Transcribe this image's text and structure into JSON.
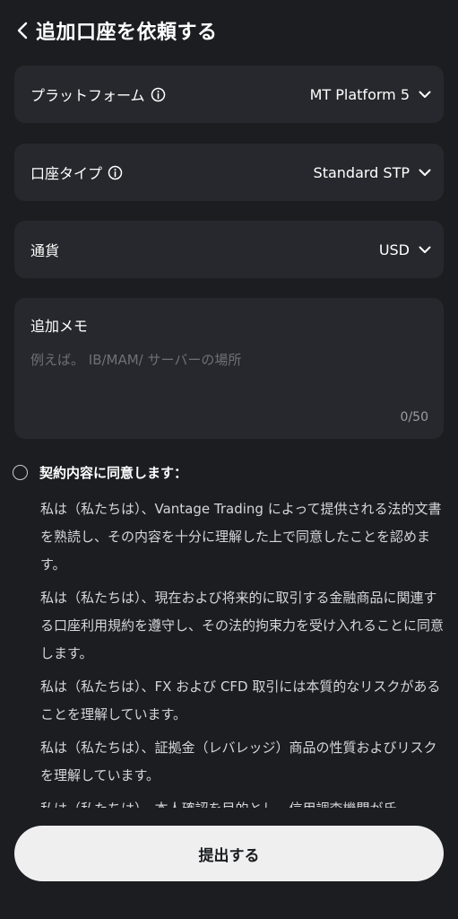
{
  "header": {
    "title": "追加口座を依頼する",
    "back_icon": "chevron-left-icon"
  },
  "fields": {
    "platform": {
      "label": "プラットフォーム",
      "value": "MT Platform 5"
    },
    "account_type": {
      "label": "口座タイプ",
      "value": "Standard STP"
    },
    "currency": {
      "label": "通貨",
      "value": "USD"
    }
  },
  "memo": {
    "label": "追加メモ",
    "placeholder": "例えば。 IB/MAM/ サーバーの場所",
    "counter": "0/50"
  },
  "agreement": {
    "label": "契約内容に同意します：",
    "terms": [
      "私は（私たちは）、Vantage Trading によって提供される法的文書を熟読し、その内容を十分に理解した上で同意したことを認めます。",
      "私は（私たちは）、現在および将来的に取引する金融商品に関連する口座利用規約を遵守し、その法的拘束力を受け入れることに同意します。",
      "私は（私たちは）、FX および CFD 取引には本質的なリスクがあることを理解しています。",
      "私は（私たちは）、証拠金（レバレッジ）商品の性質およびリスクを理解しています。",
      "私は（私たちは）、本人確認を目的とし、信用調査機関が氏"
    ]
  },
  "submit": {
    "label": "提出する"
  }
}
